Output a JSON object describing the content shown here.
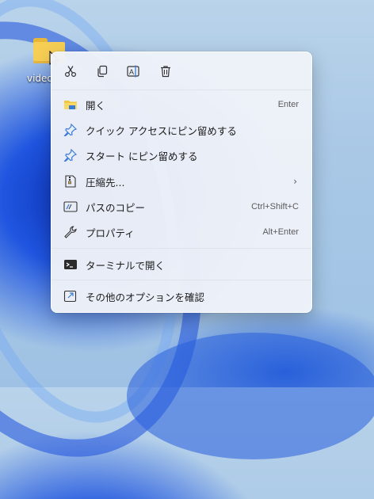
{
  "desktop": {
    "folder_label": "video"
  },
  "toolbar": {
    "buttons": [
      {
        "name": "cut-icon"
      },
      {
        "name": "copy-icon"
      },
      {
        "name": "rename-icon"
      },
      {
        "name": "delete-icon"
      }
    ]
  },
  "menu": {
    "items": [
      {
        "label": "開く",
        "shortcut": "Enter",
        "icon": "folder-icon"
      },
      {
        "label": "クイック アクセスにピン留めする",
        "shortcut": "",
        "icon": "pin-icon"
      },
      {
        "label": "スタート にピン留めする",
        "shortcut": "",
        "icon": "pin-icon"
      },
      {
        "label": "圧縮先...",
        "shortcut": "",
        "icon": "zip-icon",
        "submenu": "›"
      },
      {
        "label": "パスのコピー",
        "shortcut": "Ctrl+Shift+C",
        "icon": "copy-path-icon"
      },
      {
        "label": "プロパティ",
        "shortcut": "Alt+Enter",
        "icon": "wrench-icon"
      },
      {
        "label": "ターミナルで開く",
        "shortcut": "",
        "icon": "terminal-icon"
      },
      {
        "label": "その他のオプションを確認",
        "shortcut": "",
        "icon": "more-options-icon"
      }
    ]
  },
  "colors": {
    "accent": "#3a7bd5",
    "menu_bg": "#eef2f8"
  }
}
